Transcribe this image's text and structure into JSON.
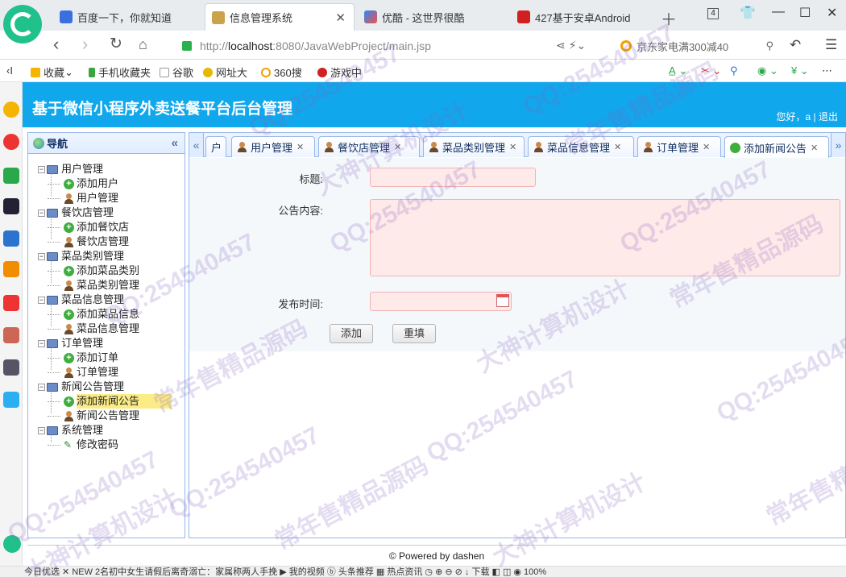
{
  "browser": {
    "tabs": [
      {
        "label": "百度一下，你就知道",
        "active": false
      },
      {
        "label": "信息管理系统",
        "active": true
      },
      {
        "label": "优酷 - 这世界很酷",
        "active": false
      },
      {
        "label": "427基于安卓Android",
        "active": false
      }
    ],
    "window_count": "4",
    "url_prefix": "http://",
    "url_host": "localhost",
    "url_path": ":8080/JavaWebProject/main.jsp",
    "search_text": "京东家电满300减40",
    "bookmarks": [
      "收藏",
      "手机收藏夹",
      "谷歌",
      "网址大",
      "360搜",
      "游戏中"
    ],
    "status_text": "今日优选    ✕  NEW  2名初中女生请假后离奇溺亡：家属称两人手挽   ▶ 我的视频   ⓑ 头条推荐   ▦ 热点资讯   ◷   ⊕   ⊖   ⊘   ↓ 下载   ◧   ◫   ◉   100%"
  },
  "header": {
    "title": "基于微信小程序外卖送餐平台后台管理",
    "user_text": "您好，a | 退出"
  },
  "nav": {
    "title": "导航",
    "groups": [
      {
        "label": "用户管理",
        "items": [
          {
            "label": "添加用户",
            "icon": "add"
          },
          {
            "label": "用户管理",
            "icon": "user"
          }
        ]
      },
      {
        "label": "餐饮店管理",
        "items": [
          {
            "label": "添加餐饮店",
            "icon": "add"
          },
          {
            "label": "餐饮店管理",
            "icon": "user"
          }
        ]
      },
      {
        "label": "菜品类别管理",
        "items": [
          {
            "label": "添加菜品类别",
            "icon": "add"
          },
          {
            "label": "菜品类别管理",
            "icon": "user"
          }
        ]
      },
      {
        "label": "菜品信息管理",
        "items": [
          {
            "label": "添加菜品信息",
            "icon": "add"
          },
          {
            "label": "菜品信息管理",
            "icon": "user"
          }
        ]
      },
      {
        "label": "订单管理",
        "items": [
          {
            "label": "添加订单",
            "icon": "add"
          },
          {
            "label": "订单管理",
            "icon": "user"
          }
        ]
      },
      {
        "label": "新闻公告管理",
        "items": [
          {
            "label": "添加新闻公告",
            "icon": "add",
            "selected": true
          },
          {
            "label": "新闻公告管理",
            "icon": "user"
          }
        ]
      },
      {
        "label": "系统管理",
        "items": [
          {
            "label": "修改密码",
            "icon": "pen"
          }
        ]
      }
    ]
  },
  "page_tabs": [
    {
      "label": "户",
      "icon": "none"
    },
    {
      "label": "用户管理",
      "icon": "user"
    },
    {
      "label": "餐饮店管理",
      "icon": "user"
    },
    {
      "label": "菜品类别管理",
      "icon": "user"
    },
    {
      "label": "菜品信息管理",
      "icon": "user"
    },
    {
      "label": "订单管理",
      "icon": "user"
    },
    {
      "label": "添加新闻公告",
      "icon": "add",
      "active": true
    }
  ],
  "form": {
    "title_label": "标题:",
    "content_label": "公告内容:",
    "time_label": "发布时间:",
    "title_value": "",
    "content_value": "",
    "time_value": "",
    "add_button": "添加",
    "reset_button": "重填"
  },
  "footer": "© Powered by dashen",
  "watermarks": [
    "QQ:254540457",
    "大神计算机设计",
    "常年售精品源码"
  ],
  "colors": {
    "header_bg": "#10a7ec",
    "panel_border": "#95b8e7",
    "selected": "#fbec88",
    "input_error_bg": "#ffeaea"
  }
}
